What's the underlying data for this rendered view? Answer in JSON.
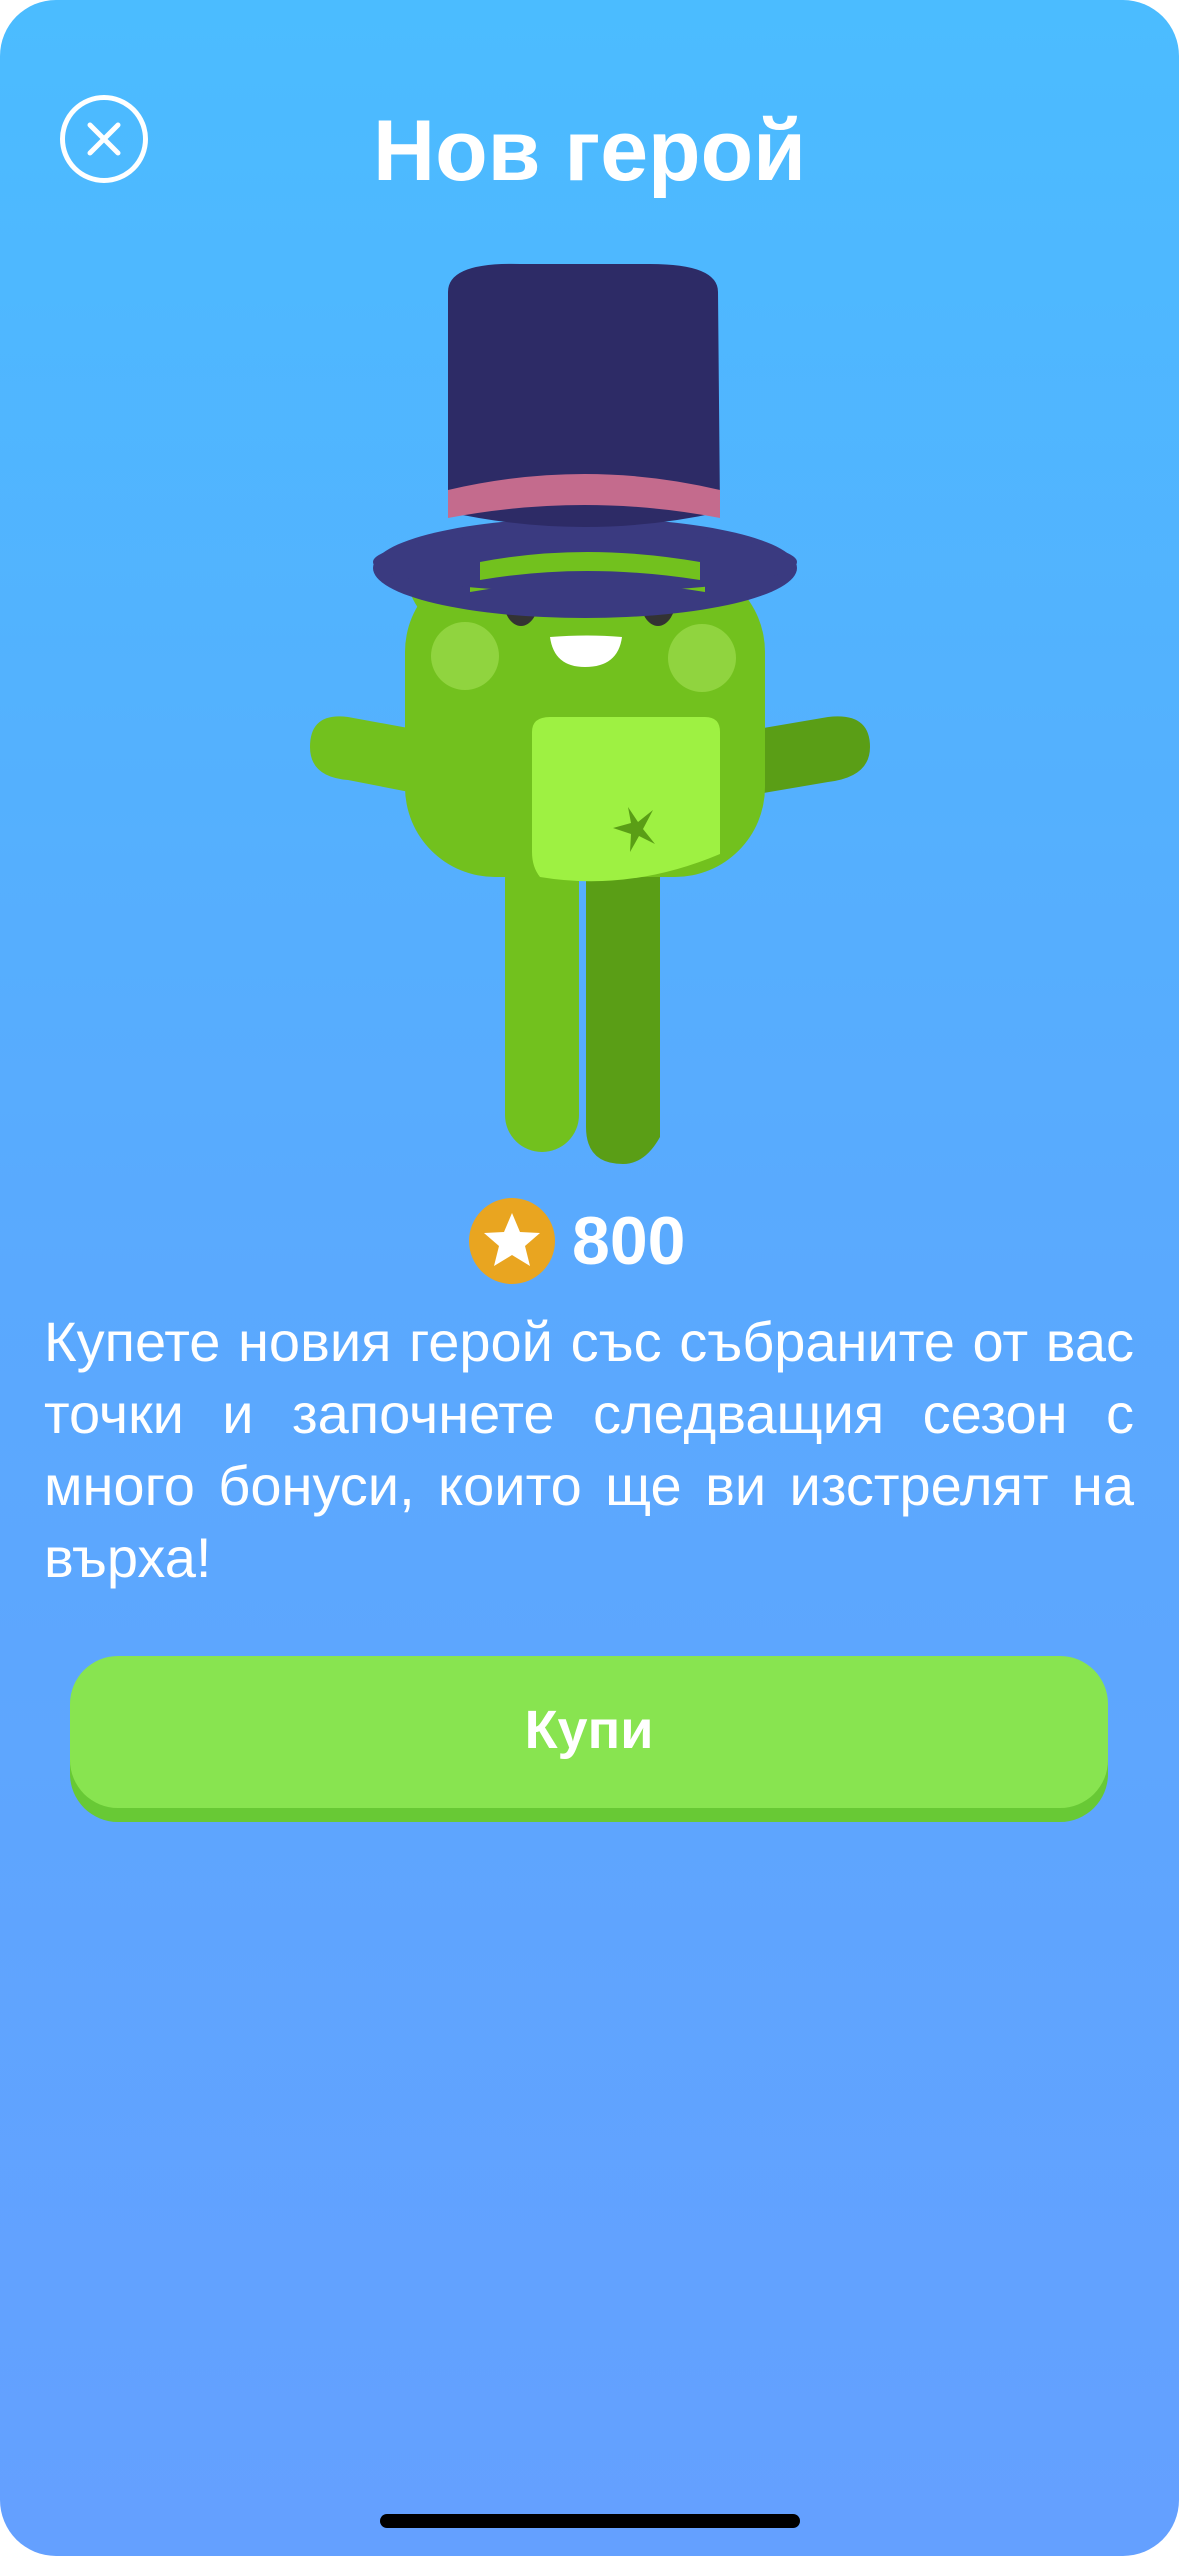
{
  "header": {
    "title": "Нов герой",
    "close_icon": "close-circle-icon"
  },
  "hero": {
    "illustration": "green-monster-with-top-hat"
  },
  "price": {
    "icon": "star-coin-icon",
    "value": "800"
  },
  "description": "Купете новия герой със събраните от вас точки и започнете следващия сезон с много бонуси, които ще ви изстрелят на върха!",
  "actions": {
    "buy_label": "Купи"
  },
  "colors": {
    "background_top": "#4bbcff",
    "background_bottom": "#64a0ff",
    "button": "#88e450",
    "button_shadow": "#68c935",
    "coin": "#e9a520"
  }
}
